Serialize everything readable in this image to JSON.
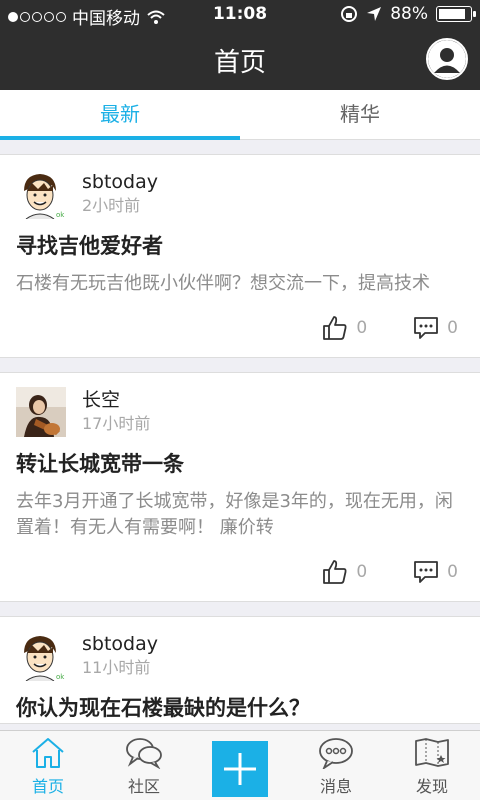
{
  "status_bar": {
    "carrier": "中国移动",
    "time": "11:08",
    "battery": "88%",
    "battery_level": 0.88,
    "signal_icon": "signal-dots-icon",
    "wifi_icon": "wifi-icon"
  },
  "nav": {
    "title": "首页",
    "profile_icon": "user-avatar-icon"
  },
  "tabs": [
    {
      "label": "最新",
      "active": true
    },
    {
      "label": "精华",
      "active": false
    }
  ],
  "posts": [
    {
      "user": "sbtoday",
      "time": "2小时前",
      "title": "寻找吉他爱好者",
      "body": "石楼有无玩吉他既小伙伴啊？想交流一下，提高技术",
      "likes": "0",
      "comments": "0"
    },
    {
      "user": "长空",
      "time": "17小时前",
      "title": "转让长城宽带一条",
      "body": "去年3月开通了长城宽带，好像是3年的，现在无用，闲置着！有无人有需要啊！ 廉价转",
      "likes": "0",
      "comments": "0"
    },
    {
      "user": "sbtoday",
      "time": "11小时前",
      "title": "你认为现在石楼最缺的是什么？",
      "body": "",
      "likes": "",
      "comments": ""
    }
  ],
  "tab_bar": [
    {
      "label": "首页",
      "icon": "home-icon",
      "active": true
    },
    {
      "label": "社区",
      "icon": "chat-bubbles-icon",
      "active": false
    },
    {
      "label": "",
      "icon": "plus-icon",
      "active": false
    },
    {
      "label": "消息",
      "icon": "message-icon",
      "active": false
    },
    {
      "label": "发现",
      "icon": "map-icon",
      "active": false
    }
  ],
  "colors": {
    "accent": "#1bb0e6",
    "nav_bg": "#2e2e2e",
    "page_bg": "#efeff4"
  }
}
